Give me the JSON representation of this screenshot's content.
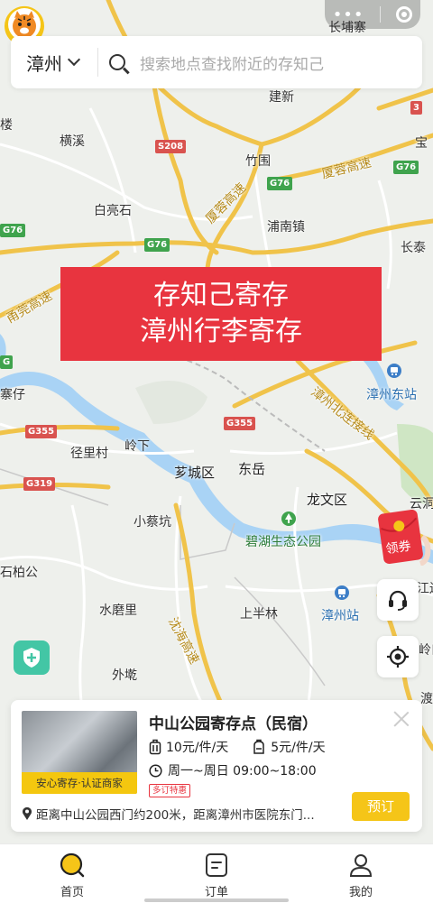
{
  "window": {
    "capsule_icons": [
      "more-dots-icon",
      "close-target-icon"
    ]
  },
  "search": {
    "city": "漳州",
    "placeholder": "搜索地点查找附近的存知己"
  },
  "banner": {
    "line1": "存知己寄存",
    "line2": "漳州行李寄存"
  },
  "map": {
    "places": {
      "changpuzhai": "长埔寨",
      "jianxin": "建新",
      "hengxi": "横溪",
      "zhuwei": "竹围",
      "baiyingshi": "白亮石",
      "punanzhen": "浦南镇",
      "changtai": "长泰",
      "baoshan": "宝",
      "lou": "楼",
      "zhaizai": "寨仔",
      "zhangzhoudongzhan": "漳州东站",
      "jinglicun": "径里村",
      "lingxia": "岭下",
      "xiangcheng": "芗城区",
      "dongyue": "东岳",
      "longwenqu": "龙文区",
      "yundong": "云洞",
      "xiaocaikeng": "小蔡坑",
      "bihu": "碧湖生态公园",
      "shibaigong": "石柏公",
      "shuimoli": "水磨里",
      "shangbanlin": "上半林",
      "zhangzhouzhan": "漳州站",
      "jiangbian": "江边",
      "waichi": "外墘",
      "lingkou": "岭口",
      "daozhu": "渡"
    },
    "roads": {
      "xiamen_high_1": "厦蓉高速",
      "xiamen_high_2": "厦蓉高速",
      "yongguan_high": "甬莞高速",
      "zhangzhou_north": "漳州北连接线",
      "shenhai_high": "沈海高速"
    },
    "shields": {
      "s208": "S208",
      "g76a": "G76",
      "g76b": "G76",
      "g76c": "G76",
      "g76d": "G76",
      "g355a": "G355",
      "g355b": "G355",
      "g319": "G319",
      "g6": "G",
      "s3": "3"
    }
  },
  "side_buttons": {
    "red_packet": "领券",
    "icons": [
      "headset-icon",
      "locate-icon"
    ]
  },
  "card": {
    "title": "中山公园寄存点（民宿）",
    "image_tag": "安心寄存·认证商家",
    "luggage_price": "10元/件/天",
    "bag_price": "5元/件/天",
    "hours": "周一~周日 09:00~18:00",
    "promo": "多订特惠",
    "distance": "距离中山公园西门约200米，距离漳州市医院东门...",
    "book": "预订"
  },
  "tabbar": {
    "items": [
      {
        "label": "首页",
        "icon": "home-search-icon",
        "active": true
      },
      {
        "label": "订单",
        "icon": "order-icon",
        "active": false
      },
      {
        "label": "我的",
        "icon": "profile-icon",
        "active": false
      }
    ]
  },
  "colors": {
    "accent": "#f5c518",
    "banner_red": "#e8343f",
    "highway": "#f0c34a",
    "water": "#a9d3f5"
  }
}
